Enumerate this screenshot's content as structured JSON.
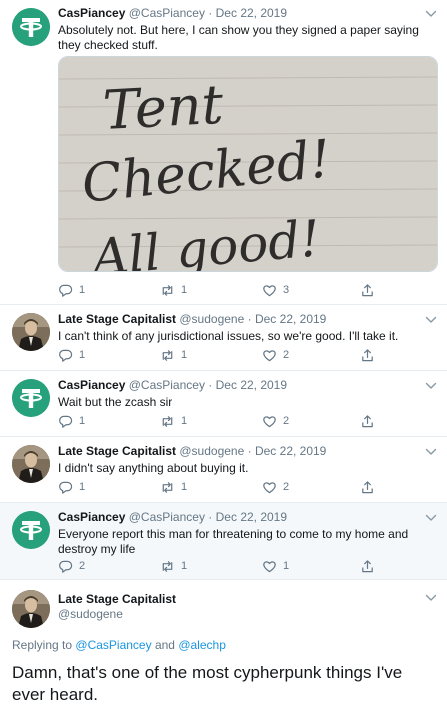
{
  "tweets": [
    {
      "name": "CasPiancey",
      "handle": "@CasPiancey",
      "date": "Dec 22, 2019",
      "text": "Absolutely not. But here, I can show you they signed a paper saying they checked stuff.",
      "photo_text": [
        "Tent",
        "Checked!",
        "All good!"
      ],
      "replies": "1",
      "retweets": "1",
      "likes": "3"
    },
    {
      "name": "Late Stage Capitalist",
      "handle": "@sudogene",
      "date": "Dec 22, 2019",
      "text": "I can't think of any jurisdictional issues, so we're good. I'll take it.",
      "replies": "1",
      "retweets": "1",
      "likes": "2"
    },
    {
      "name": "CasPiancey",
      "handle": "@CasPiancey",
      "date": "Dec 22, 2019",
      "text": "Wait but the zcash sir",
      "replies": "1",
      "retweets": "1",
      "likes": "2"
    },
    {
      "name": "Late Stage Capitalist",
      "handle": "@sudogene",
      "date": "Dec 22, 2019",
      "text": "I didn't say anything about buying it.",
      "replies": "1",
      "retweets": "1",
      "likes": "2"
    },
    {
      "name": "CasPiancey",
      "handle": "@CasPiancey",
      "date": "Dec 22, 2019",
      "text": "Everyone report this man for threatening to come to my home and destroy my life",
      "replies": "2",
      "retweets": "1",
      "likes": "1"
    }
  ],
  "focus": {
    "name": "Late Stage Capitalist",
    "handle": "@sudogene",
    "replying_prefix": "Replying to",
    "replying_user1": "@CasPiancey",
    "replying_and": "and",
    "replying_user2": "@alechp",
    "text": "Damn, that's one of the most cypherpunk things I've ever heard."
  },
  "separator": "·",
  "colors": {
    "tether_green": "#26a17b",
    "link_blue": "#1b95e0",
    "muted": "#657786",
    "highlight_bg": "#f5f8fa"
  },
  "icons": [
    "tether-logo-icon",
    "person-avatar-icon",
    "reply-icon",
    "retweet-icon",
    "like-icon",
    "share-icon",
    "chevron-down-icon"
  ]
}
